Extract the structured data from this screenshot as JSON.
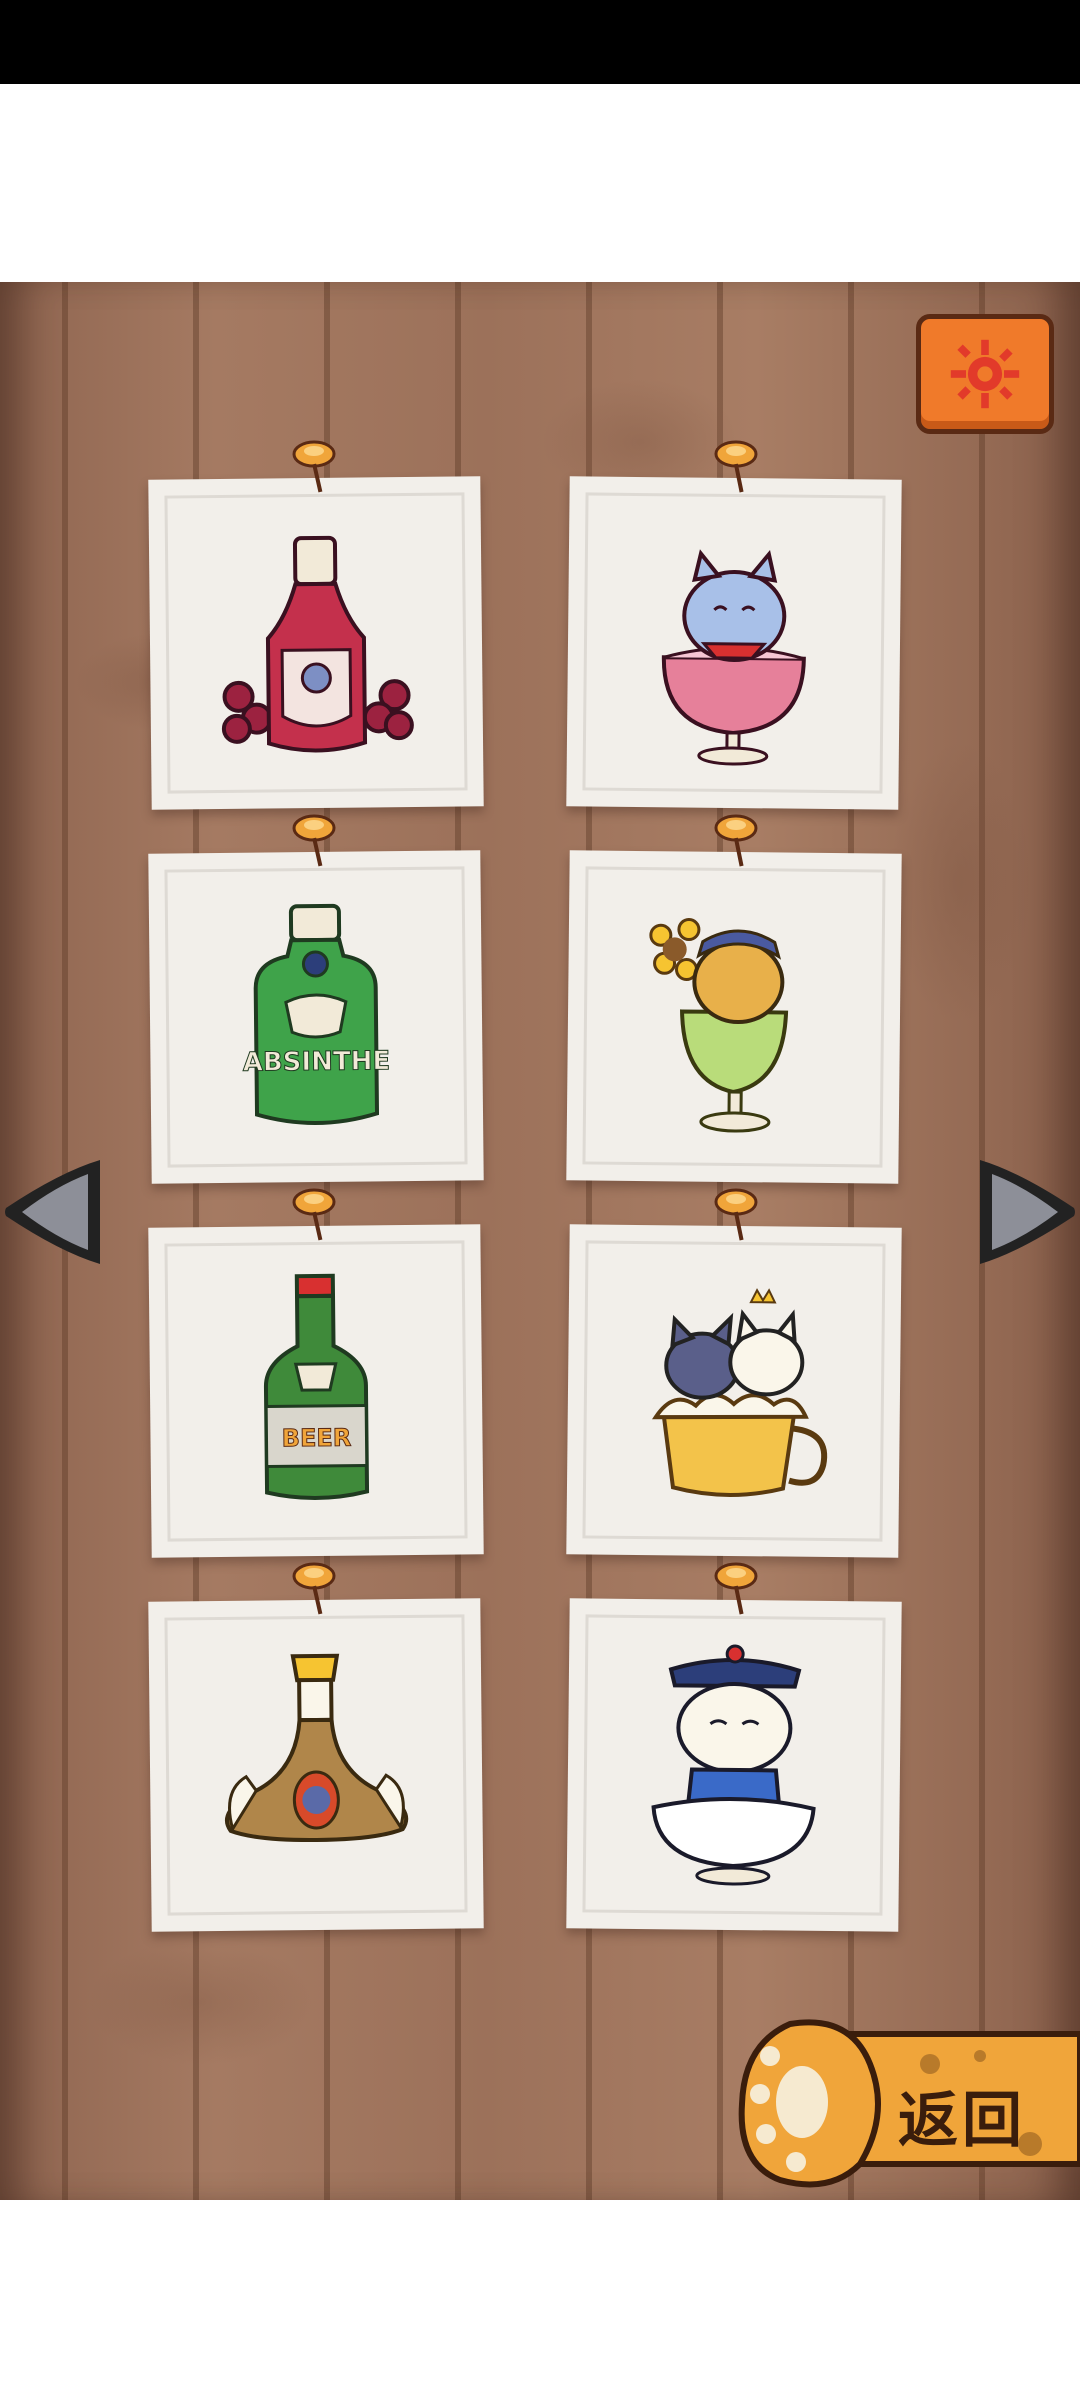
{
  "screen": "drink-collection",
  "colors": {
    "accent": "#f07a2a",
    "wood": "#a57a62",
    "card": "#f2efea"
  },
  "settings": {
    "icon": "gear-icon"
  },
  "cards": [
    {
      "name": "red-wine-bottle",
      "icon": "red-wine-bottle-icon"
    },
    {
      "name": "cat-in-wine-glass",
      "icon": "cat-wine-glass-icon"
    },
    {
      "name": "absinthe-bottle",
      "icon": "absinthe-bottle-icon",
      "label": "ABSINTHE"
    },
    {
      "name": "cat-in-absinthe-glass",
      "icon": "cat-absinthe-glass-icon"
    },
    {
      "name": "beer-bottle",
      "icon": "beer-bottle-icon",
      "label": "BEER"
    },
    {
      "name": "cats-in-beer-mug",
      "icon": "cats-beer-mug-icon"
    },
    {
      "name": "baijiu-flask",
      "icon": "baijiu-flask-icon"
    },
    {
      "name": "cat-in-bowl",
      "icon": "cat-bowl-icon"
    }
  ],
  "navigation": {
    "prev_icon": "arrow-left-icon",
    "next_icon": "arrow-right-icon"
  },
  "back_button": {
    "label": "返回",
    "icon": "paw-icon"
  }
}
